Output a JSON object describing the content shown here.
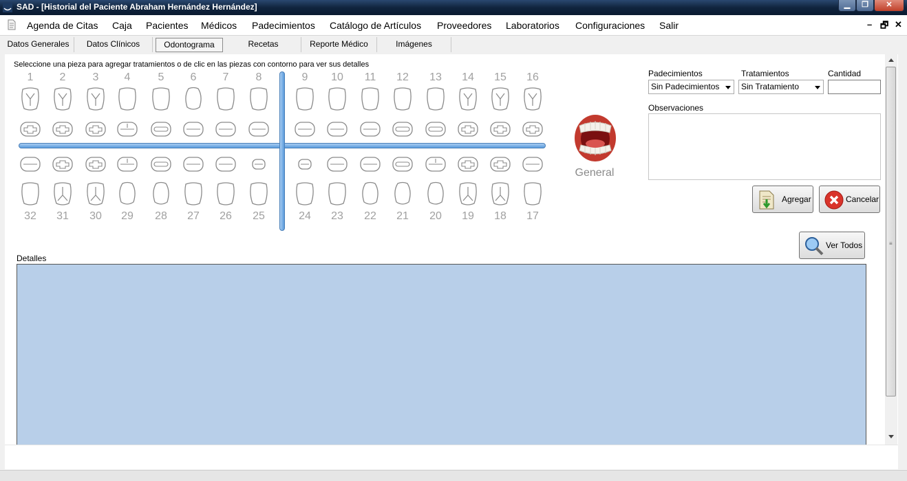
{
  "window": {
    "title": "SAD - [Historial del Paciente Abraham Hernández Hernández]"
  },
  "menu": {
    "items": [
      "Agenda de Citas",
      "Caja",
      "Pacientes",
      "Médicos",
      "Padecimientos",
      "Catálogo de Artículos",
      "Proveedores",
      "Laboratorios",
      "Configuraciones",
      "Salir"
    ]
  },
  "tabs": {
    "items": [
      "Datos Generales",
      "Datos Clínicos",
      "Odontograma",
      "Recetas",
      "Reporte Médico",
      "Imágenes"
    ],
    "active": "Odontograma"
  },
  "odontograma": {
    "instructions": "Seleccione una pieza para agregar tratamientos o de clic en las piezas con contorno para ver sus detalles",
    "upper_numbers": [
      "1",
      "2",
      "3",
      "4",
      "5",
      "6",
      "7",
      "8",
      "9",
      "10",
      "11",
      "12",
      "13",
      "14",
      "15",
      "16"
    ],
    "lower_numbers": [
      "32",
      "31",
      "30",
      "29",
      "28",
      "27",
      "26",
      "25",
      "24",
      "23",
      "22",
      "21",
      "20",
      "19",
      "18",
      "17"
    ],
    "general_label": "General"
  },
  "form": {
    "padecimientos_label": "Padecimientos",
    "padecimientos_value": "Sin Padecimientos",
    "tratamientos_label": "Tratamientos",
    "tratamientos_value": "Sin Tratamiento",
    "cantidad_label": "Cantidad",
    "cantidad_value": "",
    "observaciones_label": "Observaciones",
    "observaciones_value": "",
    "agregar_label": "Agregar",
    "cancelar_label": "Cancelar",
    "ver_todos_label": "Ver Todos"
  },
  "details": {
    "label": "Detalles"
  },
  "colors": {
    "accent": "#5b9bdc",
    "grid_bg": "#b8cfe9",
    "cancel_red": "#d9342b"
  },
  "icons": [
    "app-icon",
    "document-icon",
    "teeth-icon",
    "add-document-icon",
    "cancel-icon",
    "magnifier-icon"
  ]
}
